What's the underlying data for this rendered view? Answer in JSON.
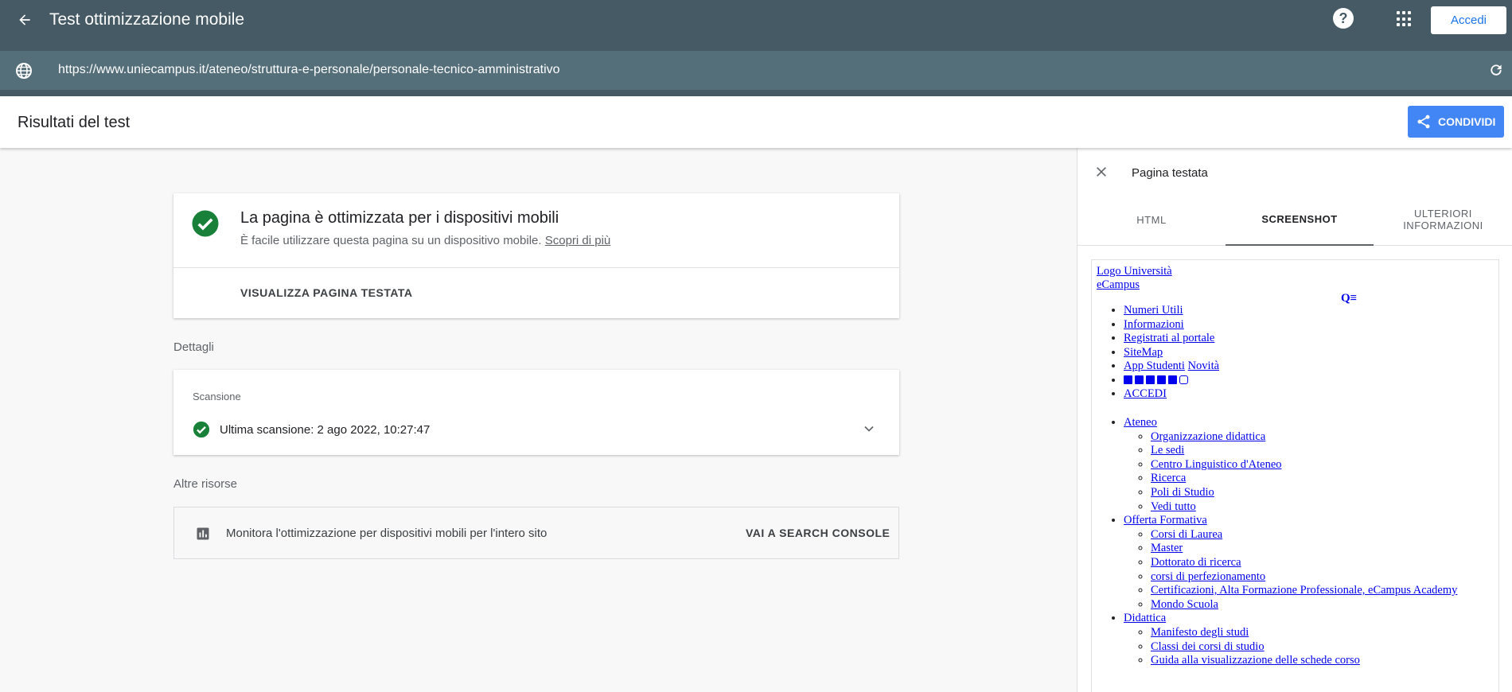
{
  "app": {
    "title": "Test ottimizzazione mobile",
    "login_label": "Accedi",
    "url": "https://www.uniecampus.it/ateneo/struttura-e-personale/personale-tecnico-amministrativo"
  },
  "header": {
    "title": "Risultati del test",
    "share_label": "CONDIVIDI"
  },
  "result": {
    "title": "La pagina è ottimizzata per i dispositivi mobili",
    "subtitle": "È facile utilizzare questa pagina su un dispositivo mobile.",
    "learn_more": "Scopri di più",
    "view_page": "VISUALIZZA PAGINA TESTATA"
  },
  "details": {
    "label": "Dettagli",
    "scan_label": "Scansione",
    "last_scan": "Ultima scansione: 2 ago 2022, 10:27:47"
  },
  "resources": {
    "label": "Altre risorse",
    "text": "Monitora l'ottimizzazione per dispositivi mobili per l'intero sito",
    "link": "VAI A SEARCH CONSOLE"
  },
  "panel": {
    "title": "Pagina testata",
    "tabs": [
      "HTML",
      "SCREENSHOT",
      "ULTERIORI INFORMAZIONI"
    ],
    "active_tab": "SCREENSHOT",
    "screenshot": {
      "logo_alt": "Logo Università eCampus",
      "top_links": [
        "Numeri Utili",
        "Informazioni",
        "Registrati al portale",
        "SiteMap",
        "App Studenti",
        "Novità",
        "ACCEDI"
      ],
      "menu": [
        {
          "label": "Ateneo",
          "children": [
            "Organizzazione didattica",
            "Le sedi",
            "Centro Linguistico d'Ateneo",
            "Ricerca",
            "Poli di Studio",
            "Vedi tutto"
          ]
        },
        {
          "label": "Offerta Formativa",
          "children": [
            "Corsi di Laurea",
            "Master",
            "Dottorato di ricerca",
            "corsi di perfezionamento",
            "Certificazioni, Alta Formazione Professionale, eCampus Academy",
            "Mondo Scuola"
          ]
        },
        {
          "label": "Didattica",
          "children": [
            "Manifesto degli studi",
            "Classi dei corsi di studio",
            "Guida alla visualizzazione delle schede corso"
          ]
        }
      ]
    }
  },
  "colors": {
    "topbar": "#455a64",
    "urlbar": "#546e7a",
    "accent": "#4285f4",
    "success": "#188038"
  }
}
